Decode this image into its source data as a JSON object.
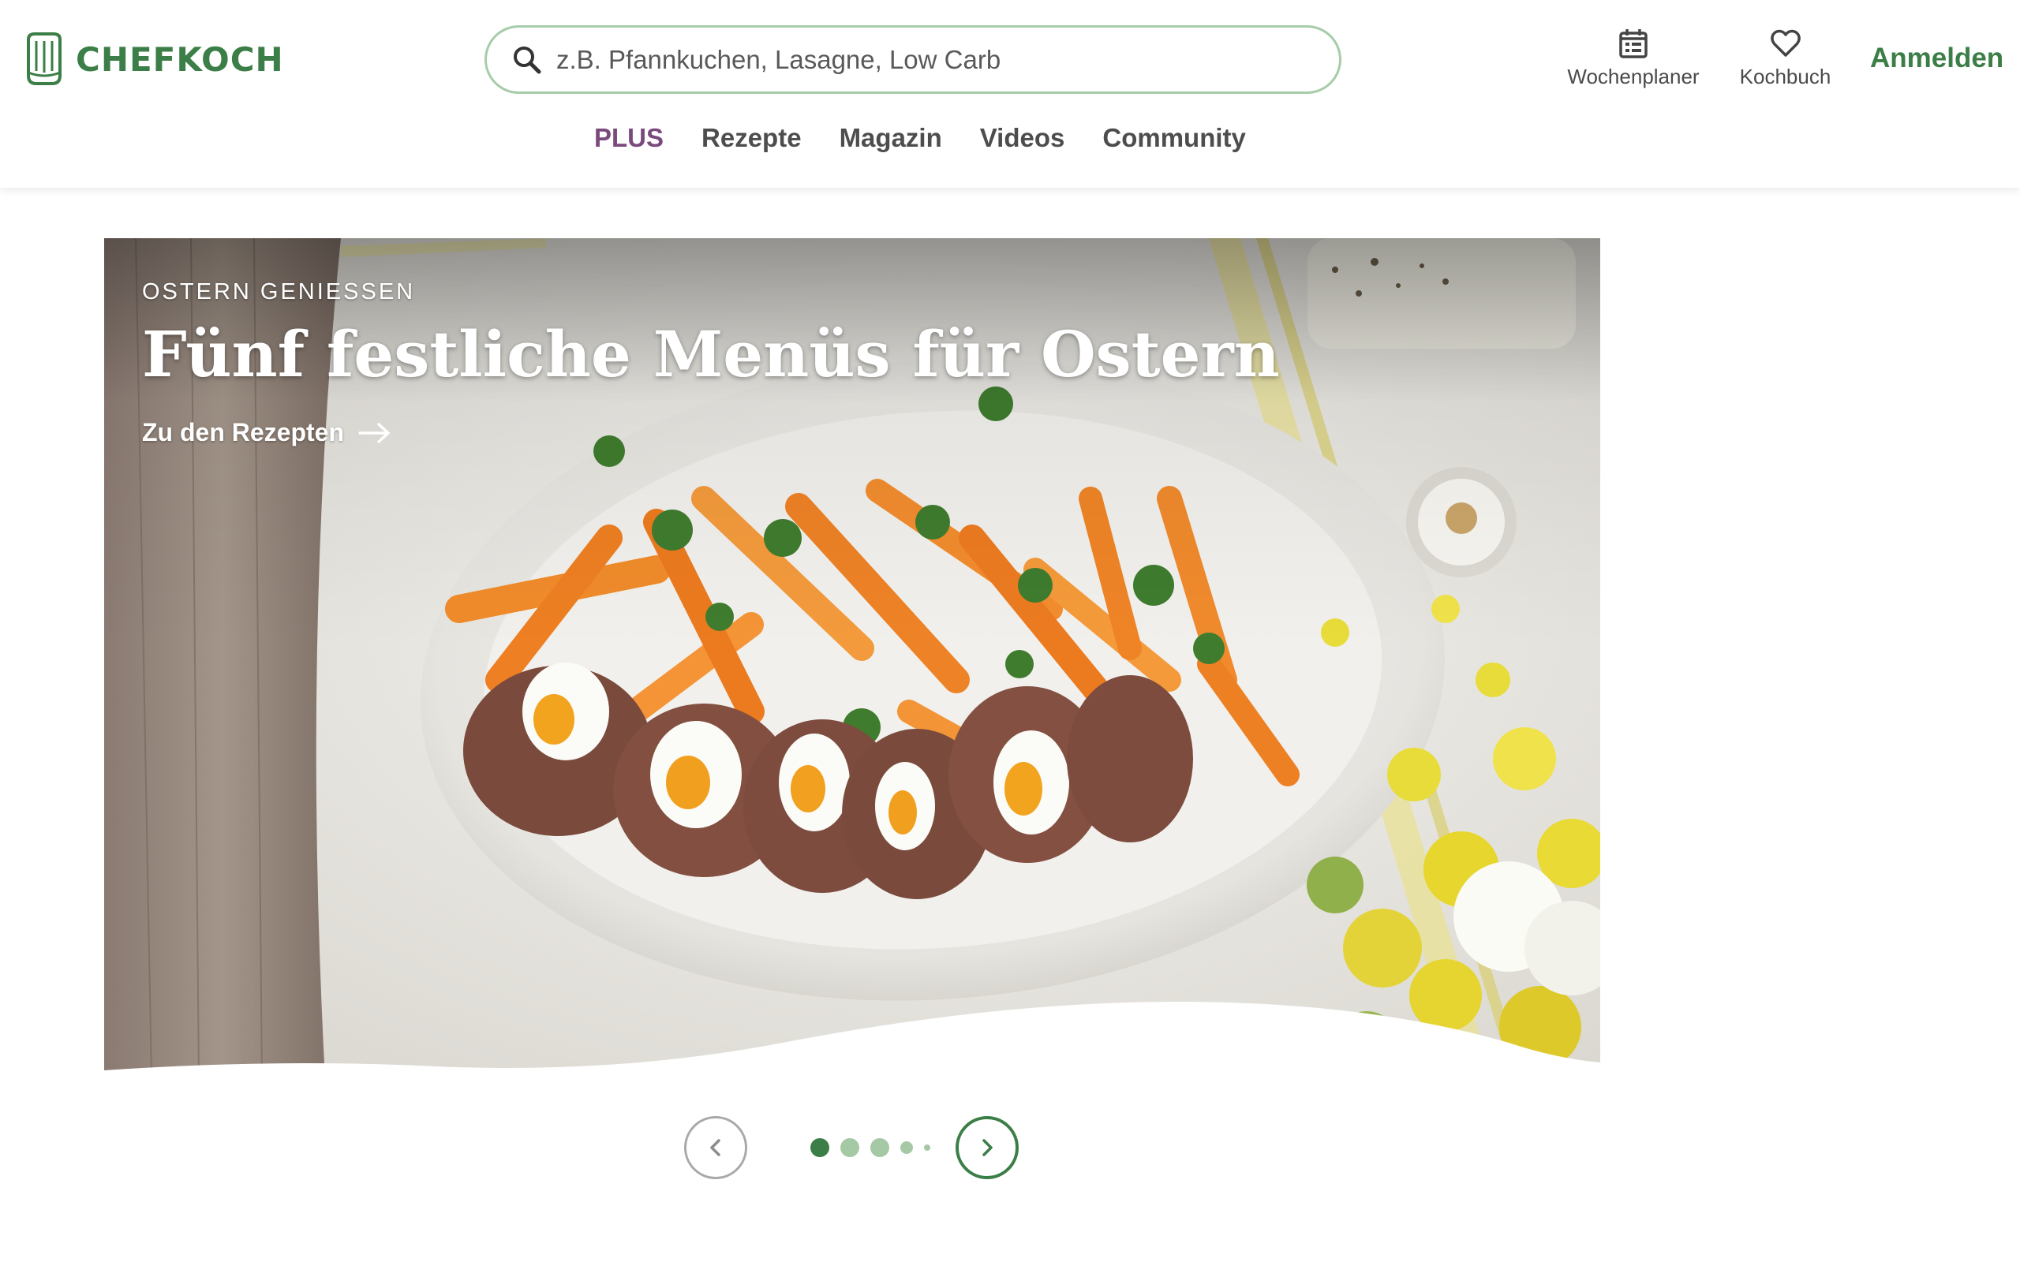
{
  "brand": {
    "name": "CHEFKOCH",
    "color": "#3c7e47"
  },
  "search": {
    "placeholder": "z.B. Pfannkuchen, Lasagne, Low Carb"
  },
  "header_actions": {
    "meal_planner": {
      "label": "Wochenplaner",
      "icon": "calendar-icon"
    },
    "cookbook": {
      "label": "Kochbuch",
      "icon": "heart-icon"
    },
    "login": "Anmelden"
  },
  "main_nav": {
    "plus": "PLUS",
    "recipes": "Rezepte",
    "magazine": "Magazin",
    "videos": "Videos",
    "community": "Community",
    "plus_color": "#7a4a7c"
  },
  "hero": {
    "overline": "OSTERN GENIESSEN",
    "title": "Fünf festliche Menüs für Ostern",
    "cta": "Zu den Rezepten",
    "image": "Easter meatloaf with boiled eggs and glazed carrots on a white platter"
  },
  "carousel": {
    "slides": 5,
    "active_index": 0,
    "prev_icon": "chevron-left-icon",
    "next_icon": "chevron-right-icon"
  }
}
